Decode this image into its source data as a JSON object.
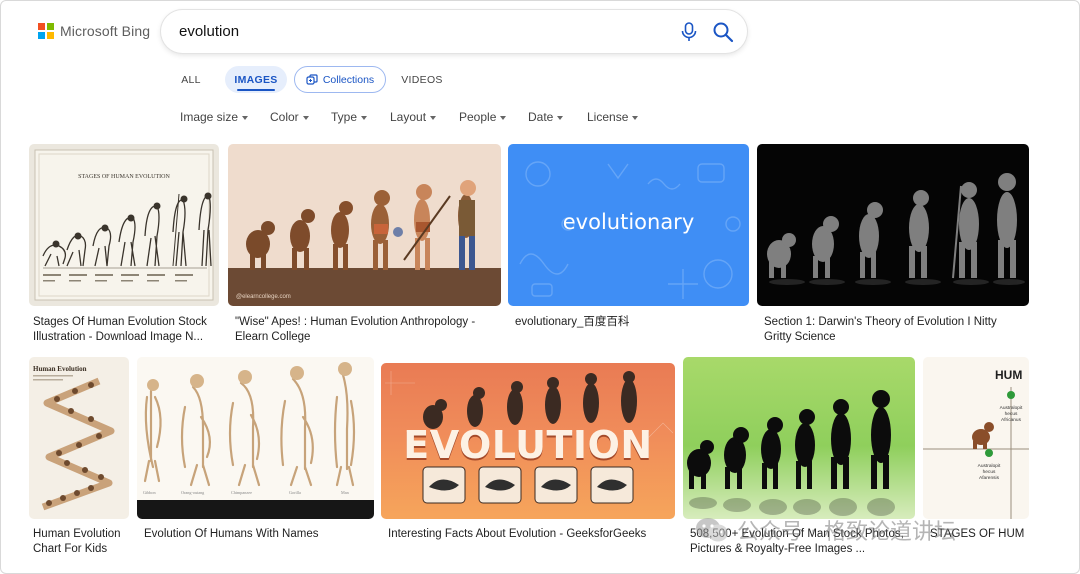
{
  "brand": {
    "name": "Microsoft Bing",
    "colors": [
      "#f25022",
      "#7fba00",
      "#00a4ef",
      "#ffb900"
    ]
  },
  "search": {
    "query": "evolution",
    "icons": [
      "microphone-icon",
      "search-icon"
    ]
  },
  "tabs": [
    {
      "label": "ALL",
      "active": false
    },
    {
      "label": "IMAGES",
      "active": true
    },
    {
      "label": "Collections",
      "active": false,
      "icon": "collections-icon"
    },
    {
      "label": "VIDEOS",
      "active": false
    }
  ],
  "filters": [
    "Image size",
    "Color",
    "Type",
    "Layout",
    "People",
    "Date",
    "License"
  ],
  "tiles": {
    "r1c1": {
      "inner_title": "STAGES OF HUMAN EVOLUTION",
      "caption": [
        "Stages Of Human Evolution Stock",
        "Illustration - Download Image N..."
      ]
    },
    "r1c2": {
      "watermark": "@elearncollege.com",
      "caption": [
        "\"Wise\" Apes! : Human Evolution Anthropology -",
        "Elearn College"
      ]
    },
    "r1c3": {
      "overlay_text": "evolutionary",
      "caption": [
        "evolutionary_百度百科"
      ]
    },
    "r1c4": {
      "caption": [
        "Section 1: Darwin's Theory of Evolution I Nitty",
        "Gritty Science"
      ]
    },
    "r2c1": {
      "inner_title": "Human Evolution",
      "caption": [
        "Human Evolution",
        "Chart For Kids"
      ]
    },
    "r2c2": {
      "stage_labels": [
        "Gibbon",
        "Orang-outang",
        "Chimpanzee",
        "Gorilla",
        "Man"
      ],
      "caption": [
        "Evolution Of Humans With Names"
      ]
    },
    "r2c3": {
      "overlay_text": "EVOLUTION",
      "caption": [
        "Interesting Facts About Evolution - GeeksforGeeks"
      ]
    },
    "r2c4": {
      "caption": [
        "508,500+ Evolution Of Man Stock Photos,",
        "Pictures & Royalty-Free Images ..."
      ]
    },
    "r2c5": {
      "inner_title": "HUM",
      "node_labels": [
        "Australopit",
        "hecus",
        "Africanus",
        "Australopit",
        "hecus",
        "Afarensis"
      ],
      "caption": [
        "STAGES OF HUM"
      ]
    }
  },
  "overlay_watermark": "公众号 · 格致论道讲坛"
}
